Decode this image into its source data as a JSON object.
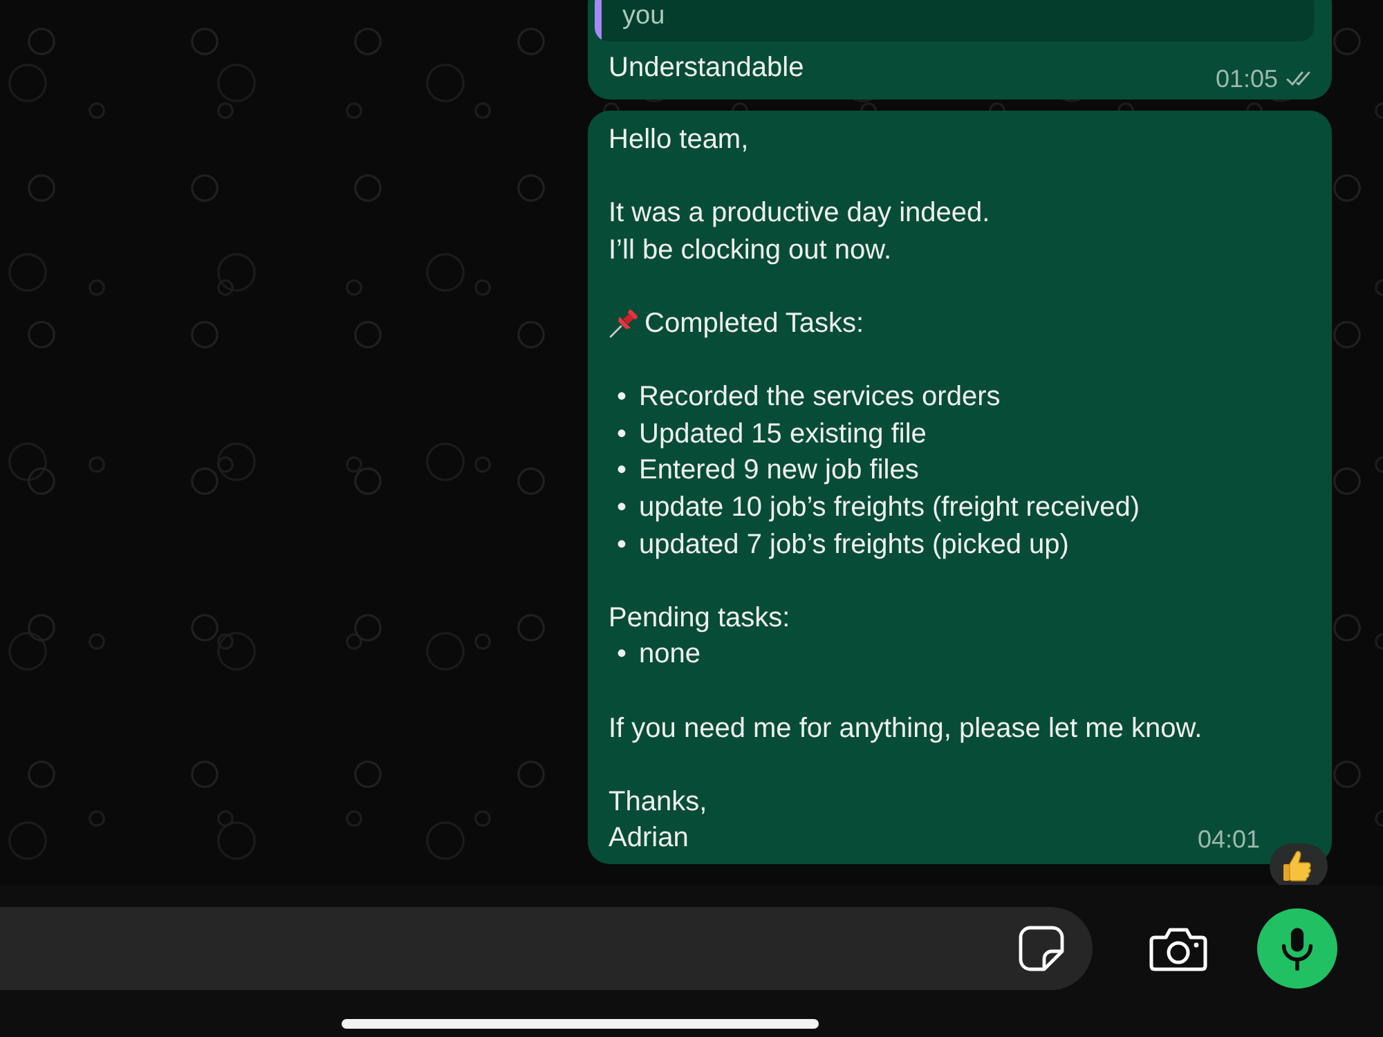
{
  "messages": [
    {
      "kind": "reply",
      "quote": {
        "text": "you"
      },
      "text": "Understandable",
      "time": "01:05",
      "delivered": true,
      "read": false
    },
    {
      "kind": "text",
      "paragraphs": [
        {
          "lines": [
            {
              "kind": "text",
              "text": "Hello team,"
            }
          ]
        },
        {
          "lines": [
            {
              "kind": "text",
              "text": "It was a productive day indeed."
            },
            {
              "kind": "text",
              "text": "I’ll be clocking out now."
            }
          ]
        },
        {
          "lines": [
            {
              "kind": "pinned",
              "text": "Completed Tasks:"
            }
          ]
        },
        {
          "lines": [
            {
              "kind": "bullet",
              "marker": "•",
              "text": "Recorded the services orders"
            },
            {
              "kind": "bullet",
              "marker": "•",
              "text": "Updated 15 existing file"
            },
            {
              "kind": "bullet",
              "marker": "•",
              "text": "Entered 9 new job files"
            },
            {
              "kind": "bullet",
              "marker": "•",
              "text": "update 10 job’s freights (freight received)"
            },
            {
              "kind": "bullet",
              "marker": "•",
              "text": "updated 7 job’s freights (picked up)"
            }
          ]
        },
        {
          "lines": [
            {
              "kind": "text",
              "text": "Pending tasks:"
            },
            {
              "kind": "bullet",
              "marker": "•",
              "text": "none"
            }
          ]
        },
        {
          "lines": [
            {
              "kind": "text",
              "text": "If you need me for anything, please let me know."
            }
          ]
        },
        {
          "lines": [
            {
              "kind": "text",
              "text": "Thanks,"
            },
            {
              "kind": "text",
              "text": "Adrian"
            }
          ]
        }
      ],
      "time": "04:01",
      "reacted": true
    }
  ]
}
